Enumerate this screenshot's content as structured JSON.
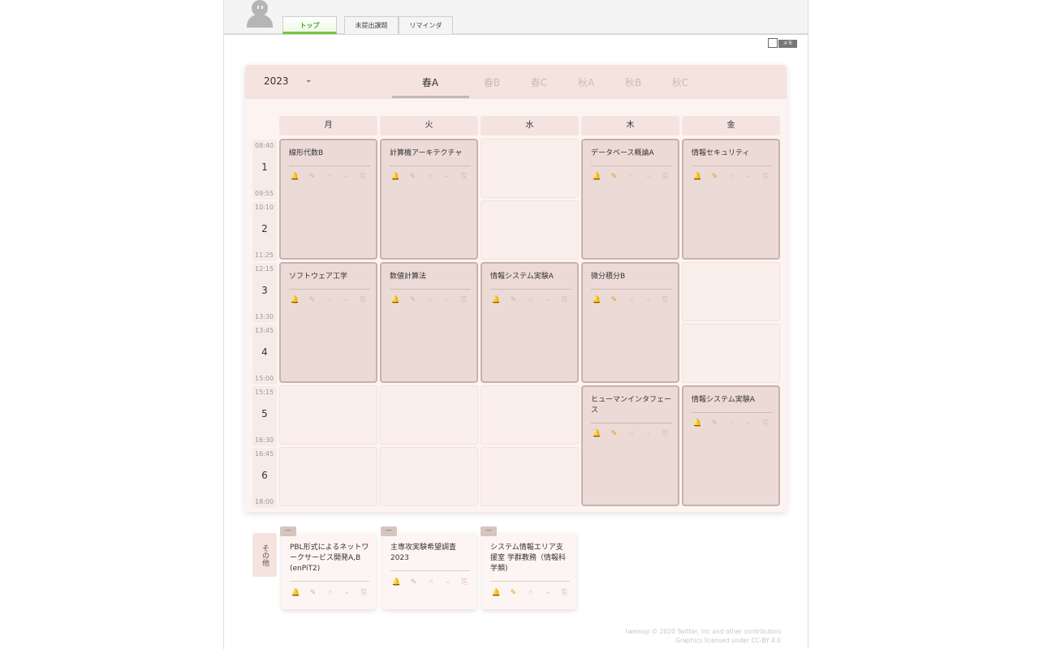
{
  "tabs": [
    {
      "label": "トップ",
      "active": true
    },
    {
      "label": "未提出課題",
      "active": false
    },
    {
      "label": "リマインダ",
      "active": false
    }
  ],
  "memo_label": "メモ",
  "year": "2023",
  "terms": [
    {
      "label": "春A",
      "active": true
    },
    {
      "label": "春B",
      "active": false
    },
    {
      "label": "春C",
      "active": false
    },
    {
      "label": "秋A",
      "active": false
    },
    {
      "label": "秋B",
      "active": false
    },
    {
      "label": "秋C",
      "active": false
    }
  ],
  "days": [
    "月",
    "火",
    "水",
    "木",
    "金"
  ],
  "periods": [
    {
      "num": "1",
      "start": "08:40",
      "end": "09:55"
    },
    {
      "num": "2",
      "start": "10:10",
      "end": "11:25"
    },
    {
      "num": "3",
      "start": "12:15",
      "end": "13:30"
    },
    {
      "num": "4",
      "start": "13:45",
      "end": "15:00"
    },
    {
      "num": "5",
      "start": "15:15",
      "end": "16:30"
    },
    {
      "num": "6",
      "start": "16:45",
      "end": "18:00"
    }
  ],
  "courses": [
    {
      "name": "線形代数B",
      "day": "月",
      "periods": "1-2",
      "pen_active": false
    },
    {
      "name": "計算機アーキテクチャ",
      "day": "火",
      "periods": "1-2",
      "pen_active": false
    },
    {
      "name": "データベース概論A",
      "day": "木",
      "periods": "1-2",
      "pen_active": true
    },
    {
      "name": "情報セキュリティ",
      "day": "金",
      "periods": "1-2",
      "pen_active": true
    },
    {
      "name": "ソフトウェア工学",
      "day": "月",
      "periods": "3-4",
      "pen_active": false
    },
    {
      "name": "数値計算法",
      "day": "火",
      "periods": "3-4",
      "pen_active": false
    },
    {
      "name": "情報システム実験A",
      "day": "水",
      "periods": "3-4",
      "pen_active": false
    },
    {
      "name": "微分積分B",
      "day": "木",
      "periods": "3-4",
      "pen_active": true
    },
    {
      "name": "ヒューマンインタフェース",
      "day": "木",
      "periods": "5-6",
      "pen_active": true
    },
    {
      "name": "情報システム実験A",
      "day": "金",
      "periods": "5-6",
      "pen_active": false
    }
  ],
  "other_label": "その他",
  "other_courses": [
    {
      "tag": "—",
      "name": "PBL形式によるネットワークサービス開発A,B (enPiT2)",
      "pen_active": false
    },
    {
      "tag": "—",
      "name": "主専攻実験希望調査2023",
      "pen_active": false
    },
    {
      "tag": "—",
      "name": "システム情報エリア支援室 学群教務（情報科学類)",
      "pen_active": true
    }
  ],
  "icon_names": [
    "bell-icon",
    "pen-icon",
    "hand-icon",
    "dash-icon",
    "copy-icon"
  ],
  "credits": {
    "line1": "twemoji © 2020 Twitter, Inc and other contributors",
    "line2": "Graphics licensed under CC-BY 4.0"
  }
}
